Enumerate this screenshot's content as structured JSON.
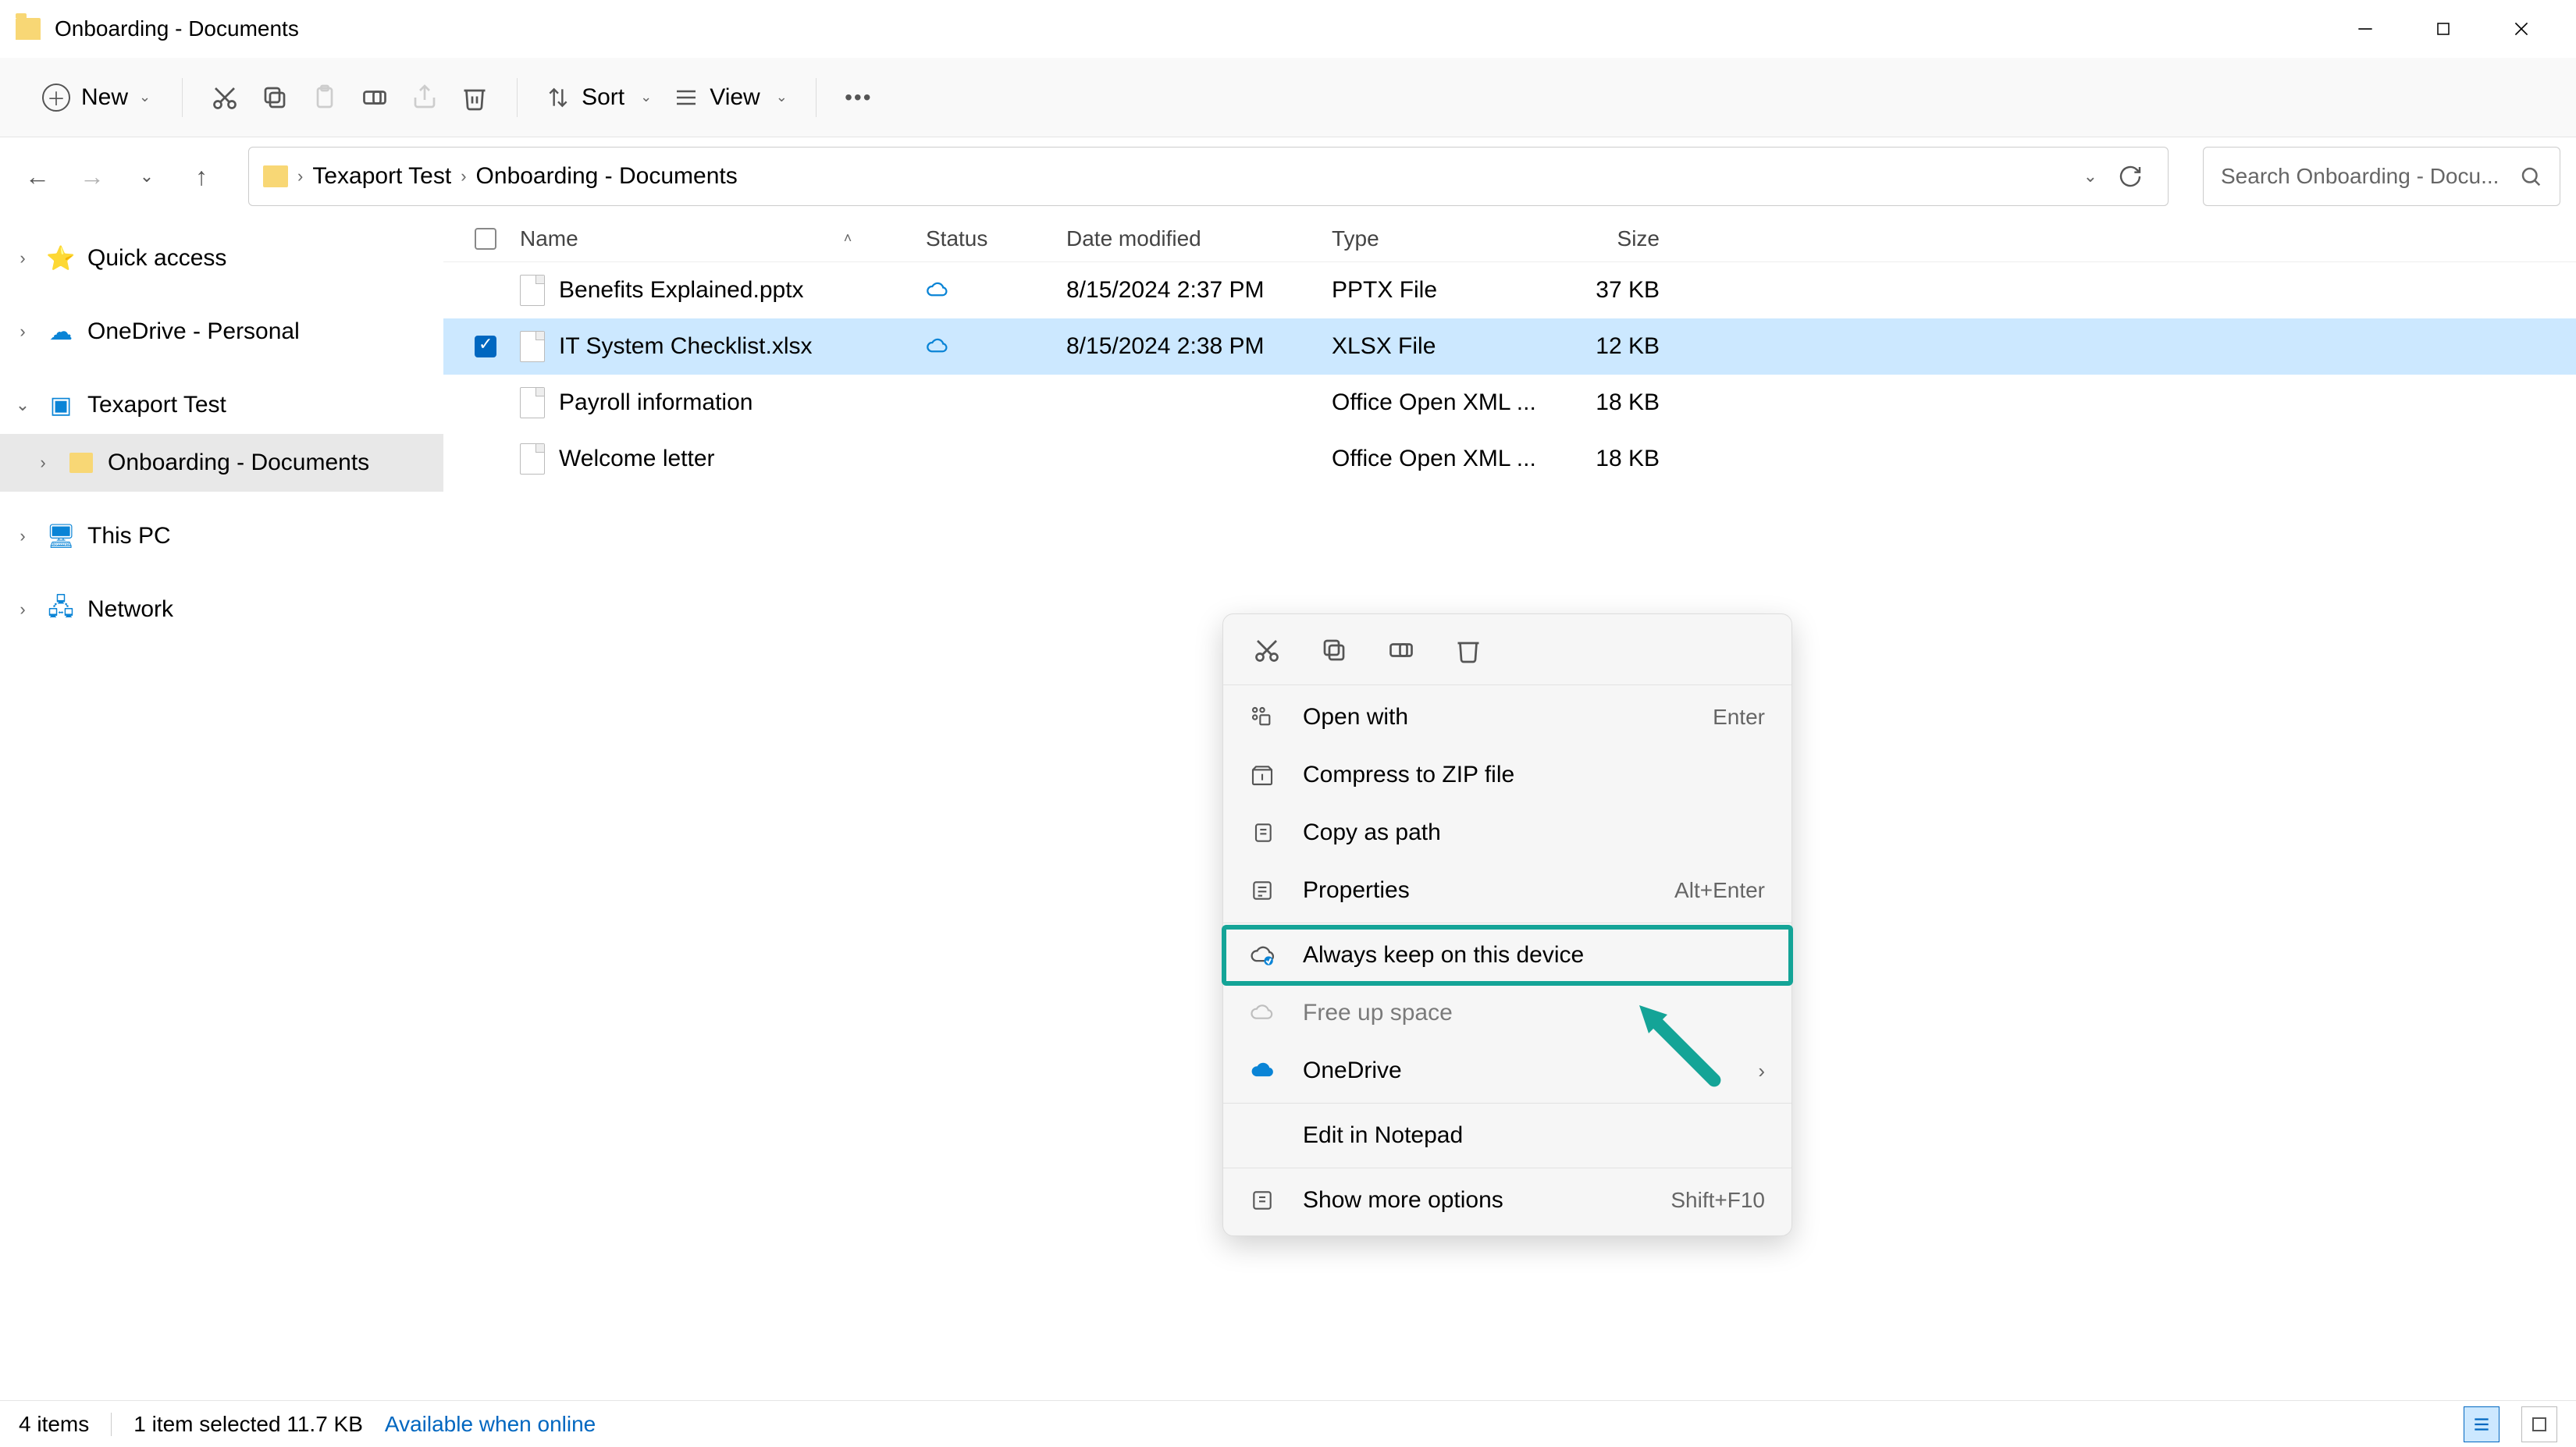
{
  "window": {
    "title": "Onboarding - Documents"
  },
  "toolbar": {
    "new": "New",
    "sort": "Sort",
    "view": "View"
  },
  "breadcrumb": {
    "root": "Texaport Test",
    "current": "Onboarding - Documents"
  },
  "search": {
    "placeholder": "Search Onboarding - Docu..."
  },
  "columns": {
    "name": "Name",
    "status": "Status",
    "date": "Date modified",
    "type": "Type",
    "size": "Size"
  },
  "rows": [
    {
      "name": "Benefits Explained.pptx",
      "date": "8/15/2024 2:37 PM",
      "type": "PPTX File",
      "size": "37 KB",
      "selected": false,
      "cloud": true
    },
    {
      "name": "IT System Checklist.xlsx",
      "date": "8/15/2024 2:38 PM",
      "type": "XLSX File",
      "size": "12 KB",
      "selected": true,
      "cloud": true
    },
    {
      "name": "Payroll information",
      "date": "",
      "type": "Office Open XML ...",
      "size": "18 KB",
      "selected": false,
      "cloud": false
    },
    {
      "name": "Welcome letter",
      "date": "",
      "type": "Office Open XML ...",
      "size": "18 KB",
      "selected": false,
      "cloud": false
    }
  ],
  "sidebar": {
    "quick": "Quick access",
    "onedrive": "OneDrive - Personal",
    "texaport": "Texaport Test",
    "onboarding": "Onboarding - Documents",
    "thispc": "This PC",
    "network": "Network"
  },
  "ctx": {
    "openwith": "Open with",
    "openwith_k": "Enter",
    "zip": "Compress to ZIP file",
    "copypath": "Copy as path",
    "props": "Properties",
    "props_k": "Alt+Enter",
    "keep": "Always keep on this device",
    "free": "Free up space",
    "onedrive": "OneDrive",
    "notepad": "Edit in Notepad",
    "more": "Show more options",
    "more_k": "Shift+F10"
  },
  "status": {
    "items": "4 items",
    "sel": "1 item selected  11.7 KB",
    "avail": "Available when online"
  }
}
